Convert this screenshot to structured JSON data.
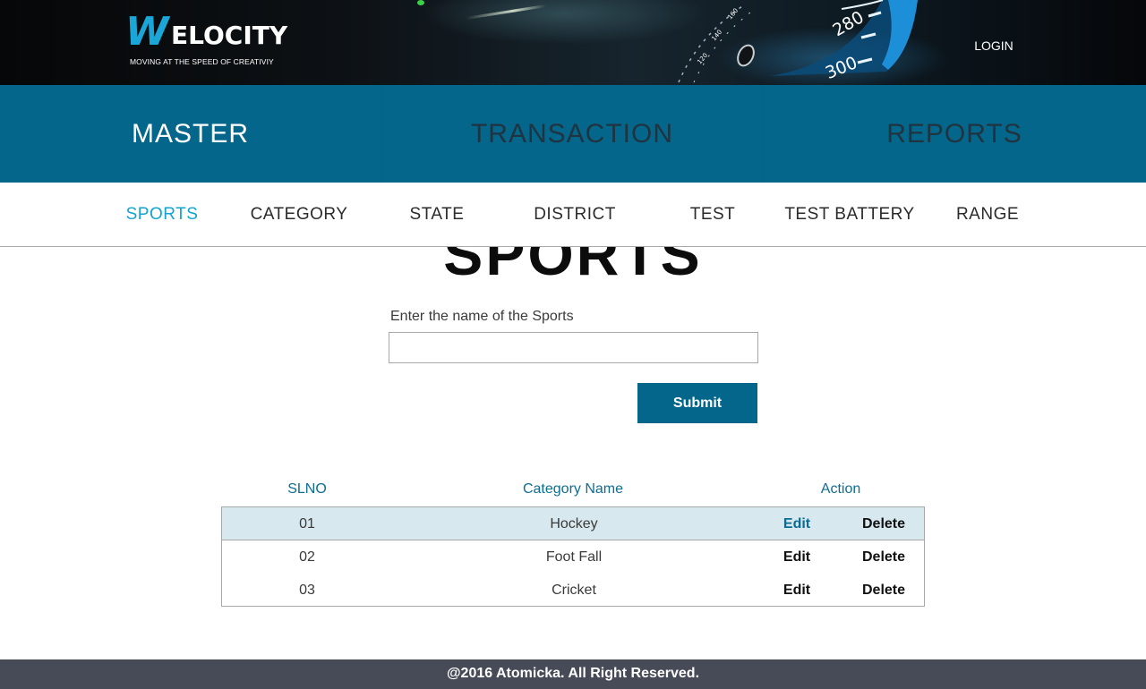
{
  "header": {
    "logo": {
      "mark": "W",
      "text": "ELOCITY",
      "tagline": "MOVING AT THE SPEED OF CREATIVIY"
    },
    "login_label": "LOGIN",
    "speedometer": {
      "labels": [
        "280",
        "300"
      ]
    }
  },
  "main_nav": {
    "tabs": [
      {
        "label": "MASTER",
        "active": true
      },
      {
        "label": "TRANSACTION",
        "active": false
      },
      {
        "label": "REPORTS",
        "active": false
      }
    ]
  },
  "sub_nav": {
    "items": [
      {
        "label": "SPORTS",
        "active": true
      },
      {
        "label": "CATEGORY",
        "active": false
      },
      {
        "label": "STATE",
        "active": false
      },
      {
        "label": "DISTRICT",
        "active": false
      },
      {
        "label": "TEST",
        "active": false
      },
      {
        "label": "TEST BATTERY",
        "active": false
      },
      {
        "label": "RANGE",
        "active": false
      }
    ]
  },
  "page": {
    "title": "SPORTS",
    "form": {
      "label": "Enter the name of the Sports",
      "value": "",
      "placeholder": "",
      "submit_label": "Submit"
    }
  },
  "table": {
    "columns": [
      "SLNO",
      "Category Name",
      "Action"
    ],
    "rows": [
      {
        "slno": "01",
        "name": "Hockey",
        "edit": "Edit",
        "delete": "Delete",
        "highlighted": true
      },
      {
        "slno": "02",
        "name": "Foot Fall",
        "edit": "Edit",
        "delete": "Delete",
        "highlighted": false
      },
      {
        "slno": "03",
        "name": "Cricket",
        "edit": "Edit",
        "delete": "Delete",
        "highlighted": false
      }
    ]
  },
  "footer": {
    "text": "@2016 Atomicka. All Right Reserved."
  },
  "colors": {
    "brand": "#04668a",
    "accent": "#12a4d1",
    "footer_bg": "#464b57",
    "highlight_row": "#d7e8ee"
  }
}
